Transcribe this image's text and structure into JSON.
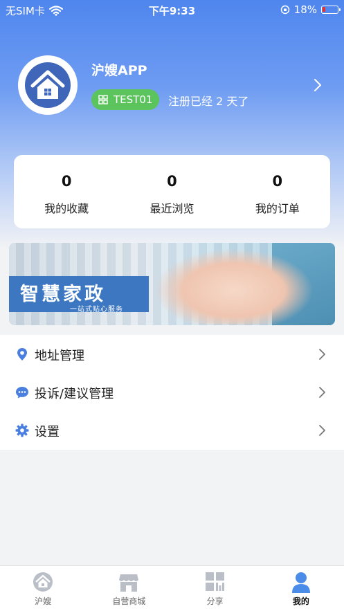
{
  "status_bar": {
    "carrier": "无SIM卡",
    "time": "下午9:33",
    "battery_text": "18%",
    "battery_level": 0.18
  },
  "profile": {
    "name": "沪嫂APP",
    "code": "TEST01",
    "registration_text": "注册已经 2 天了"
  },
  "stats": [
    {
      "value": "0",
      "label": "我的收藏"
    },
    {
      "value": "0",
      "label": "最近浏览"
    },
    {
      "value": "0",
      "label": "我的订单"
    }
  ],
  "banner": {
    "title": "智慧家政",
    "subtitle": "一站式贴心服务"
  },
  "menu": [
    {
      "label": "地址管理",
      "icon": "location-pin-icon"
    },
    {
      "label": "投诉/建议管理",
      "icon": "chat-bubble-icon"
    },
    {
      "label": "设置",
      "icon": "gear-icon"
    }
  ],
  "tabs": [
    {
      "label": "沪嫂",
      "icon": "home-icon",
      "active": false
    },
    {
      "label": "自营商城",
      "icon": "store-icon",
      "active": false
    },
    {
      "label": "分享",
      "icon": "grid-icon",
      "active": false
    },
    {
      "label": "我的",
      "icon": "person-icon",
      "active": true
    }
  ],
  "colors": {
    "header_blue": "#4f86ee",
    "badge_green": "#5cc45c",
    "icon_blue": "#4a7fe0",
    "battery_red": "#e33333"
  }
}
